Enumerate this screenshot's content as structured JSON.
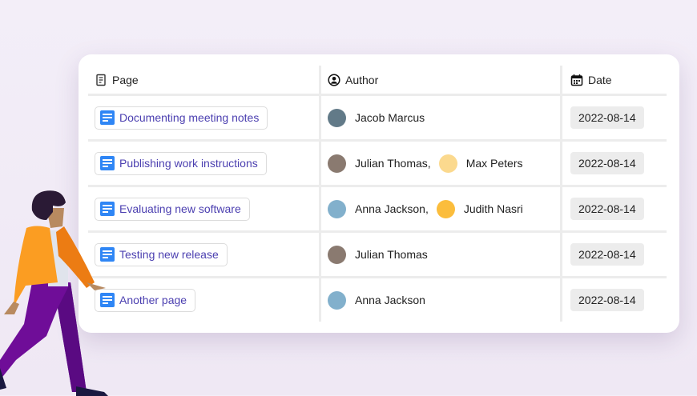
{
  "headers": {
    "page": "Page",
    "author": "Author",
    "date": "Date"
  },
  "rows": [
    {
      "page": "Documenting meeting notes",
      "authors": [
        {
          "name": "Jacob Marcus",
          "color": "#627a88"
        }
      ],
      "date": "2022-08-14"
    },
    {
      "page": "Publishing work instructions",
      "authors": [
        {
          "name": "Julian Thomas,",
          "color": "#8a7a70"
        },
        {
          "name": "Max Peters",
          "color": "#fbd98e"
        }
      ],
      "date": "2022-08-14"
    },
    {
      "page": "Evaluating new software",
      "authors": [
        {
          "name": "Anna Jackson,",
          "color": "#82b0cc"
        },
        {
          "name": "Judith Nasri",
          "color": "#fbbd3c"
        }
      ],
      "date": "2022-08-14"
    },
    {
      "page": "Testing new release",
      "authors": [
        {
          "name": "Julian Thomas",
          "color": "#8a7a70"
        }
      ],
      "date": "2022-08-14"
    },
    {
      "page": "Another page",
      "authors": [
        {
          "name": "Anna Jackson",
          "color": "#82b0cc"
        }
      ],
      "date": "2022-08-14"
    }
  ]
}
